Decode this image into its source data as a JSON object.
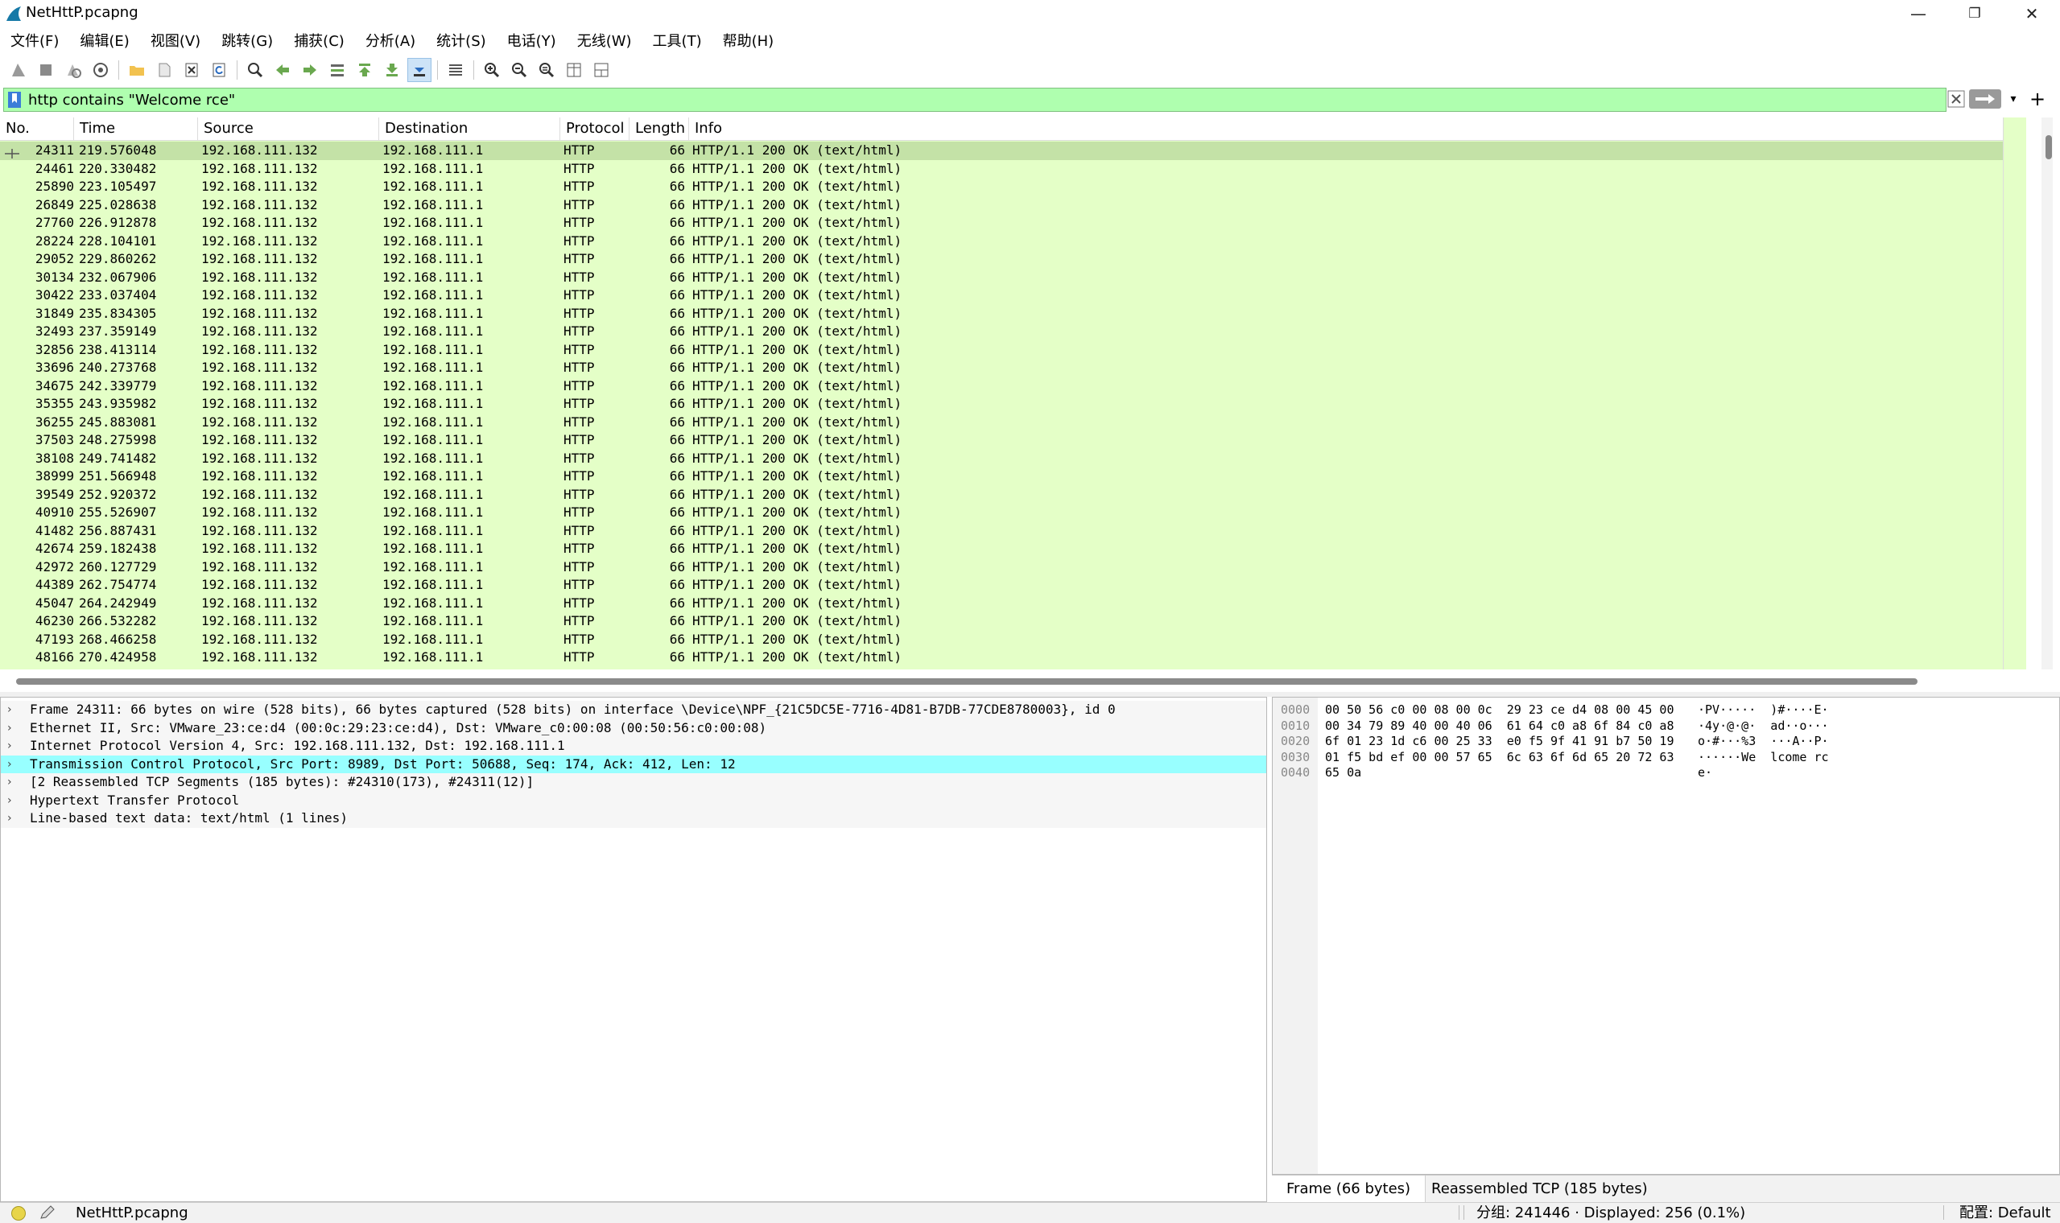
{
  "window": {
    "title": "NetHttP.pcapng",
    "controls": {
      "minimize": "—",
      "restore": "❐",
      "close": "✕"
    }
  },
  "menu": [
    "文件(F)",
    "编辑(E)",
    "视图(V)",
    "跳转(G)",
    "捕获(C)",
    "分析(A)",
    "统计(S)",
    "电话(Y)",
    "无线(W)",
    "工具(T)",
    "帮助(H)"
  ],
  "toolbar": {
    "buttons": [
      "start-capture-icon",
      "stop-capture-icon",
      "restart-capture-icon",
      "capture-options-icon",
      "open-file-icon",
      "save-file-icon",
      "close-file-icon",
      "reload-file-icon",
      "find-packet-icon",
      "go-back-icon",
      "go-forward-icon",
      "go-to-packet-icon",
      "go-first-icon",
      "go-last-icon",
      "autoscroll-icon",
      "colorize-icon",
      "zoom-in-icon",
      "zoom-out-icon",
      "zoom-normal-icon",
      "resize-columns-icon",
      "layout-icon"
    ]
  },
  "filter": {
    "value": "http contains \"Welcome rce\"",
    "background": "#afffaf"
  },
  "packet_list": {
    "columns": [
      "No.",
      "Time",
      "Source",
      "Destination",
      "Protocol",
      "Length",
      "Info"
    ],
    "row_color": "#e4ffc7",
    "selected_color": "#c4e2a7",
    "rows": [
      {
        "no": "24311",
        "time": "219.576048",
        "src": "192.168.111.132",
        "dst": "192.168.111.1",
        "proto": "HTTP",
        "len": "66",
        "info": "HTTP/1.1 200 OK  (text/html)"
      },
      {
        "no": "24461",
        "time": "220.330482",
        "src": "192.168.111.132",
        "dst": "192.168.111.1",
        "proto": "HTTP",
        "len": "66",
        "info": "HTTP/1.1 200 OK  (text/html)"
      },
      {
        "no": "25890",
        "time": "223.105497",
        "src": "192.168.111.132",
        "dst": "192.168.111.1",
        "proto": "HTTP",
        "len": "66",
        "info": "HTTP/1.1 200 OK  (text/html)"
      },
      {
        "no": "26849",
        "time": "225.028638",
        "src": "192.168.111.132",
        "dst": "192.168.111.1",
        "proto": "HTTP",
        "len": "66",
        "info": "HTTP/1.1 200 OK  (text/html)"
      },
      {
        "no": "27760",
        "time": "226.912878",
        "src": "192.168.111.132",
        "dst": "192.168.111.1",
        "proto": "HTTP",
        "len": "66",
        "info": "HTTP/1.1 200 OK  (text/html)"
      },
      {
        "no": "28224",
        "time": "228.104101",
        "src": "192.168.111.132",
        "dst": "192.168.111.1",
        "proto": "HTTP",
        "len": "66",
        "info": "HTTP/1.1 200 OK  (text/html)"
      },
      {
        "no": "29052",
        "time": "229.860262",
        "src": "192.168.111.132",
        "dst": "192.168.111.1",
        "proto": "HTTP",
        "len": "66",
        "info": "HTTP/1.1 200 OK  (text/html)"
      },
      {
        "no": "30134",
        "time": "232.067906",
        "src": "192.168.111.132",
        "dst": "192.168.111.1",
        "proto": "HTTP",
        "len": "66",
        "info": "HTTP/1.1 200 OK  (text/html)"
      },
      {
        "no": "30422",
        "time": "233.037404",
        "src": "192.168.111.132",
        "dst": "192.168.111.1",
        "proto": "HTTP",
        "len": "66",
        "info": "HTTP/1.1 200 OK  (text/html)"
      },
      {
        "no": "31849",
        "time": "235.834305",
        "src": "192.168.111.132",
        "dst": "192.168.111.1",
        "proto": "HTTP",
        "len": "66",
        "info": "HTTP/1.1 200 OK  (text/html)"
      },
      {
        "no": "32493",
        "time": "237.359149",
        "src": "192.168.111.132",
        "dst": "192.168.111.1",
        "proto": "HTTP",
        "len": "66",
        "info": "HTTP/1.1 200 OK  (text/html)"
      },
      {
        "no": "32856",
        "time": "238.413114",
        "src": "192.168.111.132",
        "dst": "192.168.111.1",
        "proto": "HTTP",
        "len": "66",
        "info": "HTTP/1.1 200 OK  (text/html)"
      },
      {
        "no": "33696",
        "time": "240.273768",
        "src": "192.168.111.132",
        "dst": "192.168.111.1",
        "proto": "HTTP",
        "len": "66",
        "info": "HTTP/1.1 200 OK  (text/html)"
      },
      {
        "no": "34675",
        "time": "242.339779",
        "src": "192.168.111.132",
        "dst": "192.168.111.1",
        "proto": "HTTP",
        "len": "66",
        "info": "HTTP/1.1 200 OK  (text/html)"
      },
      {
        "no": "35355",
        "time": "243.935982",
        "src": "192.168.111.132",
        "dst": "192.168.111.1",
        "proto": "HTTP",
        "len": "66",
        "info": "HTTP/1.1 200 OK  (text/html)"
      },
      {
        "no": "36255",
        "time": "245.883081",
        "src": "192.168.111.132",
        "dst": "192.168.111.1",
        "proto": "HTTP",
        "len": "66",
        "info": "HTTP/1.1 200 OK  (text/html)"
      },
      {
        "no": "37503",
        "time": "248.275998",
        "src": "192.168.111.132",
        "dst": "192.168.111.1",
        "proto": "HTTP",
        "len": "66",
        "info": "HTTP/1.1 200 OK  (text/html)"
      },
      {
        "no": "38108",
        "time": "249.741482",
        "src": "192.168.111.132",
        "dst": "192.168.111.1",
        "proto": "HTTP",
        "len": "66",
        "info": "HTTP/1.1 200 OK  (text/html)"
      },
      {
        "no": "38999",
        "time": "251.566948",
        "src": "192.168.111.132",
        "dst": "192.168.111.1",
        "proto": "HTTP",
        "len": "66",
        "info": "HTTP/1.1 200 OK  (text/html)"
      },
      {
        "no": "39549",
        "time": "252.920372",
        "src": "192.168.111.132",
        "dst": "192.168.111.1",
        "proto": "HTTP",
        "len": "66",
        "info": "HTTP/1.1 200 OK  (text/html)"
      },
      {
        "no": "40910",
        "time": "255.526907",
        "src": "192.168.111.132",
        "dst": "192.168.111.1",
        "proto": "HTTP",
        "len": "66",
        "info": "HTTP/1.1 200 OK  (text/html)"
      },
      {
        "no": "41482",
        "time": "256.887431",
        "src": "192.168.111.132",
        "dst": "192.168.111.1",
        "proto": "HTTP",
        "len": "66",
        "info": "HTTP/1.1 200 OK  (text/html)"
      },
      {
        "no": "42674",
        "time": "259.182438",
        "src": "192.168.111.132",
        "dst": "192.168.111.1",
        "proto": "HTTP",
        "len": "66",
        "info": "HTTP/1.1 200 OK  (text/html)"
      },
      {
        "no": "42972",
        "time": "260.127729",
        "src": "192.168.111.132",
        "dst": "192.168.111.1",
        "proto": "HTTP",
        "len": "66",
        "info": "HTTP/1.1 200 OK  (text/html)"
      },
      {
        "no": "44389",
        "time": "262.754774",
        "src": "192.168.111.132",
        "dst": "192.168.111.1",
        "proto": "HTTP",
        "len": "66",
        "info": "HTTP/1.1 200 OK  (text/html)"
      },
      {
        "no": "45047",
        "time": "264.242949",
        "src": "192.168.111.132",
        "dst": "192.168.111.1",
        "proto": "HTTP",
        "len": "66",
        "info": "HTTP/1.1 200 OK  (text/html)"
      },
      {
        "no": "46230",
        "time": "266.532282",
        "src": "192.168.111.132",
        "dst": "192.168.111.1",
        "proto": "HTTP",
        "len": "66",
        "info": "HTTP/1.1 200 OK  (text/html)"
      },
      {
        "no": "47193",
        "time": "268.466258",
        "src": "192.168.111.132",
        "dst": "192.168.111.1",
        "proto": "HTTP",
        "len": "66",
        "info": "HTTP/1.1 200 OK  (text/html)"
      },
      {
        "no": "48166",
        "time": "270.424958",
        "src": "192.168.111.132",
        "dst": "192.168.111.1",
        "proto": "HTTP",
        "len": "66",
        "info": "HTTP/1.1 200 OK  (text/html)"
      }
    ]
  },
  "details": {
    "selected_color": "#98ffff",
    "rows": [
      "Frame 24311: 66 bytes on wire (528 bits), 66 bytes captured (528 bits) on interface \\Device\\NPF_{21C5DC5E-7716-4D81-B7DB-77CDE8780003}, id 0",
      "Ethernet II, Src: VMware_23:ce:d4 (00:0c:29:23:ce:d4), Dst: VMware_c0:00:08 (00:50:56:c0:00:08)",
      "Internet Protocol Version 4, Src: 192.168.111.132, Dst: 192.168.111.1",
      "Transmission Control Protocol, Src Port: 8989, Dst Port: 50688, Seq: 174, Ack: 412, Len: 12",
      "[2 Reassembled TCP Segments (185 bytes): #24310(173), #24311(12)]",
      "Hypertext Transfer Protocol",
      "Line-based text data: text/html (1 lines)"
    ]
  },
  "bytes": {
    "rows": [
      {
        "offset": "0000",
        "hex": "00 50 56 c0 00 08 00 0c  29 23 ce d4 08 00 45 00",
        "ascii": "·PV·····  )#····E·"
      },
      {
        "offset": "0010",
        "hex": "00 34 79 89 40 00 40 06  61 64 c0 a8 6f 84 c0 a8",
        "ascii": "·4y·@·@·  ad··o···"
      },
      {
        "offset": "0020",
        "hex": "6f 01 23 1d c6 00 25 33  e0 f5 9f 41 91 b7 50 19",
        "ascii": "o·#···%3  ···A··P·"
      },
      {
        "offset": "0030",
        "hex": "01 f5 bd ef 00 00 57 65  6c 63 6f 6d 65 20 72 63",
        "ascii": "······We  lcome rc"
      },
      {
        "offset": "0040",
        "hex": "65 0a",
        "ascii": "e·"
      }
    ],
    "tabs": [
      "Frame (66 bytes)",
      "Reassembled TCP (185 bytes)"
    ]
  },
  "status": {
    "file": "NetHttP.pcapng",
    "packets": "分组: 241446 · Displayed: 256 (0.1%)",
    "profile": "配置: Default"
  }
}
